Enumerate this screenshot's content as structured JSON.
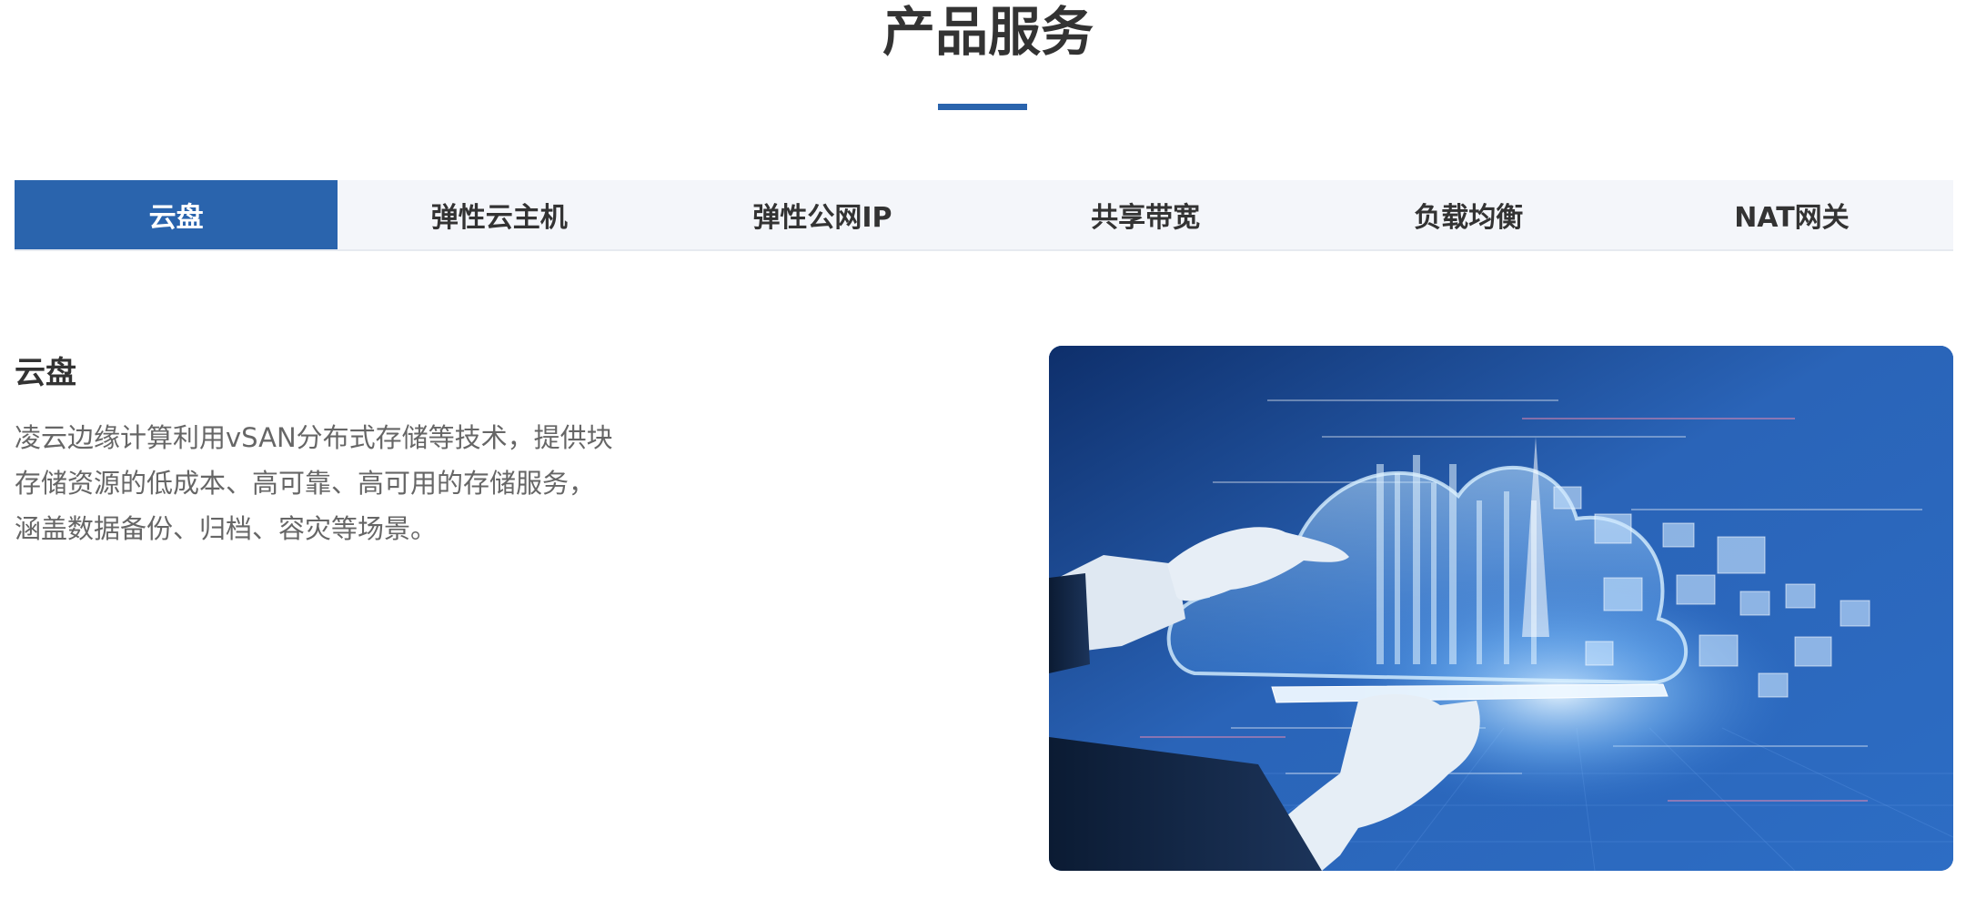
{
  "section": {
    "title": "产品服务"
  },
  "tabs": [
    {
      "label": "云盘",
      "active": true
    },
    {
      "label": "弹性云主机",
      "active": false
    },
    {
      "label": "弹性公网IP",
      "active": false
    },
    {
      "label": "共享带宽",
      "active": false
    },
    {
      "label": "负载均衡",
      "active": false
    },
    {
      "label": "NAT网关",
      "active": false
    }
  ],
  "content": {
    "title": "云盘",
    "description": "凌云边缘计算利用vSAN分布式存储等技术，提供块\n存储资源的低成本、高可靠、高可用的存储服务，\n涵盖数据备份、归档、容灾等场景。"
  },
  "colors": {
    "accent": "#2a64ad",
    "tab_bg": "#f4f6fa"
  }
}
